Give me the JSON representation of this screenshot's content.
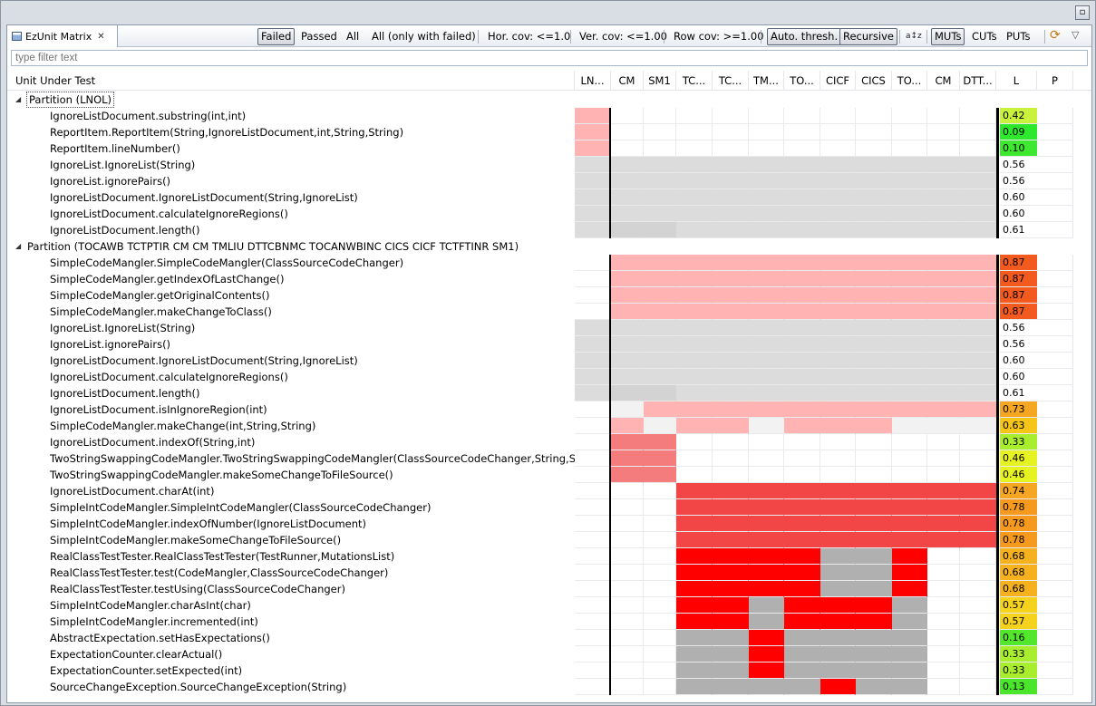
{
  "window": {
    "maximize_glyph": "▫"
  },
  "view": {
    "tab_title": "EzUnit Matrix",
    "tab_close": "✕"
  },
  "toolbar": {
    "failed": "Failed",
    "passed": "Passed",
    "all": "All",
    "all_only_failed": "All (only with failed)",
    "hor_cov": "Hor. cov: <=1.0",
    "ver_cov": "Ver. cov: <=1.00",
    "row_cov": "Row cov: >=1.00",
    "auto_thresh": "Auto. thresh.",
    "recursive": "Recursive",
    "sort_icon_glyph": "a↕z",
    "muts": "MUTs",
    "cuts": "CUTs",
    "puts": "PUTs",
    "sync_icon_glyph": "⟳",
    "menu_icon_glyph": "▽"
  },
  "filter": {
    "placeholder": "type filter text"
  },
  "columns": {
    "uut": "Unit Under Test",
    "matrix": [
      "LN...",
      "CM",
      "SM1",
      "TC...",
      "TC...",
      "TM...",
      "TO...",
      "CICF",
      "CICS",
      "TO...",
      "CM",
      "DTT..."
    ],
    "l": "L",
    "p": "P"
  },
  "colors": {
    "P": "#ffb3b3",
    "X": "#dcdcdc",
    "Y": "#d3d3d3",
    "Q": "#f2f2f2",
    "M": "#f47c7c",
    "R": "#f24545",
    "S": "#ff0000",
    "G": "#b0b0b0",
    "_": "#ffffff"
  },
  "rows": [
    {
      "type": "partition",
      "label": "Partition (LNOL)"
    },
    {
      "type": "item",
      "label": "IgnoreListDocument.substring(int,int)",
      "cells": "P___________",
      "L": "0.42",
      "Lc": "#c8f23c"
    },
    {
      "type": "item",
      "label": "ReportItem.ReportItem(String,IgnoreListDocument,int,String,String)",
      "cells": "P___________",
      "L": "0.09",
      "Lc": "#2ee82e"
    },
    {
      "type": "item",
      "label": "ReportItem.lineNumber()",
      "cells": "P___________",
      "L": "0.10",
      "Lc": "#3ee830"
    },
    {
      "type": "item",
      "label": "IgnoreList.IgnoreList(String)",
      "cells": "XXXXXXXXXXXX",
      "L": "0.56",
      "Lc": "#ffffff"
    },
    {
      "type": "item",
      "label": "IgnoreList.ignorePairs()",
      "cells": "XXXXXXXXXXXX",
      "L": "0.56",
      "Lc": "#ffffff"
    },
    {
      "type": "item",
      "label": "IgnoreListDocument.IgnoreListDocument(String,IgnoreList)",
      "cells": "XXXXXXXXXXXX",
      "L": "0.60",
      "Lc": "#ffffff"
    },
    {
      "type": "item",
      "label": "IgnoreListDocument.calculateIgnoreRegions()",
      "cells": "XXXXXXXXXXXX",
      "L": "0.60",
      "Lc": "#ffffff"
    },
    {
      "type": "item",
      "label": "IgnoreListDocument.length()",
      "cells": "XYYXXXXXXXXX",
      "L": "0.61",
      "Lc": "#ffffff"
    },
    {
      "type": "partition",
      "label": "Partition (TOCAWB TCTPTIR CM CM TMLIU DTTCBNMC TOCANWBINC CICS CICF TCTFTINR SM1)"
    },
    {
      "type": "item",
      "label": "SimpleCodeMangler.SimpleCodeMangler(ClassSourceCodeChanger)",
      "cells": "_PPPPPPPPPPP",
      "L": "0.87",
      "Lc": "#f25a1e"
    },
    {
      "type": "item",
      "label": "SimpleCodeMangler.getIndexOfLastChange()",
      "cells": "_PPPPPPPPPPP",
      "L": "0.87",
      "Lc": "#f25a1e"
    },
    {
      "type": "item",
      "label": "SimpleCodeMangler.getOriginalContents()",
      "cells": "_PPPPPPPPPPP",
      "L": "0.87",
      "Lc": "#f25a1e"
    },
    {
      "type": "item",
      "label": "SimpleCodeMangler.makeChangeToClass()",
      "cells": "_PPPPPPPPPPP",
      "L": "0.87",
      "Lc": "#f25a1e"
    },
    {
      "type": "item",
      "label": "IgnoreList.IgnoreList(String)",
      "cells": "XXXXXXXXXXXX",
      "L": "0.56",
      "Lc": "#ffffff"
    },
    {
      "type": "item",
      "label": "IgnoreList.ignorePairs()",
      "cells": "XXXXXXXXXXXX",
      "L": "0.56",
      "Lc": "#ffffff"
    },
    {
      "type": "item",
      "label": "IgnoreListDocument.IgnoreListDocument(String,IgnoreList)",
      "cells": "XXXXXXXXXXXX",
      "L": "0.60",
      "Lc": "#ffffff"
    },
    {
      "type": "item",
      "label": "IgnoreListDocument.calculateIgnoreRegions()",
      "cells": "XXXXXXXXXXXX",
      "L": "0.60",
      "Lc": "#ffffff"
    },
    {
      "type": "item",
      "label": "IgnoreListDocument.length()",
      "cells": "XYYXXXXXXXXX",
      "L": "0.61",
      "Lc": "#ffffff"
    },
    {
      "type": "item",
      "label": "IgnoreListDocument.isInIgnoreRegion(int)",
      "cells": "_QPPPPPPPPPP",
      "L": "0.73",
      "Lc": "#f5a623"
    },
    {
      "type": "item",
      "label": "SimpleCodeMangler.makeChange(int,String,String)",
      "cells": "_PQPPQPPPQQQ",
      "L": "0.63",
      "Lc": "#f5c518"
    },
    {
      "type": "item",
      "label": "IgnoreListDocument.indexOf(String,int)",
      "cells": "_MM_________",
      "L": "0.33",
      "Lc": "#a8ee2e"
    },
    {
      "type": "item",
      "label": "TwoStringSwappingCodeMangler.TwoStringSwappingCodeMangler(ClassSourceCodeChanger,String,String)",
      "cells": "_MM_________",
      "L": "0.46",
      "Lc": "#e6f221"
    },
    {
      "type": "item",
      "label": "TwoStringSwappingCodeMangler.makeSomeChangeToFileSource()",
      "cells": "_MM_________",
      "L": "0.46",
      "Lc": "#e6f221"
    },
    {
      "type": "item",
      "label": "IgnoreListDocument.charAt(int)",
      "cells": "___RRRRRRRRR",
      "L": "0.74",
      "Lc": "#f5a623"
    },
    {
      "type": "item",
      "label": "SimpleIntCodeMangler.SimpleIntCodeMangler(ClassSourceCodeChanger)",
      "cells": "___RRRRRRRRR",
      "L": "0.78",
      "Lc": "#f59a1e"
    },
    {
      "type": "item",
      "label": "SimpleIntCodeMangler.indexOfNumber(IgnoreListDocument)",
      "cells": "___RRRRRRRRR",
      "L": "0.78",
      "Lc": "#f59a1e"
    },
    {
      "type": "item",
      "label": "SimpleIntCodeMangler.makeSomeChangeToFileSource()",
      "cells": "___RRRRRRRRR",
      "L": "0.78",
      "Lc": "#f59a1e"
    },
    {
      "type": "item",
      "label": "RealClassTestTester.RealClassTestTester(TestRunner,MutationsList)",
      "cells": "___SSSSGGS__",
      "L": "0.68",
      "Lc": "#f5b21e"
    },
    {
      "type": "item",
      "label": "RealClassTestTester.test(CodeMangler,ClassSourceCodeChanger)",
      "cells": "___SSSSGGS__",
      "L": "0.68",
      "Lc": "#f5b21e"
    },
    {
      "type": "item",
      "label": "RealClassTestTester.testUsing(ClassSourceCodeChanger)",
      "cells": "___SSSSGGS__",
      "L": "0.68",
      "Lc": "#f5b21e"
    },
    {
      "type": "item",
      "label": "SimpleIntCodeMangler.charAsInt(char)",
      "cells": "___SSGSSSG__",
      "L": "0.57",
      "Lc": "#f5d21e"
    },
    {
      "type": "item",
      "label": "SimpleIntCodeMangler.incremented(int)",
      "cells": "___SSGSSSG__",
      "L": "0.57",
      "Lc": "#f5d21e"
    },
    {
      "type": "item",
      "label": "AbstractExpectation.setHasExpectations()",
      "cells": "___GGSGGGG__",
      "L": "0.16",
      "Lc": "#52e62c"
    },
    {
      "type": "item",
      "label": "ExpectationCounter.clearActual()",
      "cells": "___GGSGGGG__",
      "L": "0.33",
      "Lc": "#a8ee2e"
    },
    {
      "type": "item",
      "label": "ExpectationCounter.setExpected(int)",
      "cells": "___GGSGGGG__",
      "L": "0.33",
      "Lc": "#a8ee2e"
    },
    {
      "type": "item",
      "label": "SourceChangeException.SourceChangeException(String)",
      "cells": "___GGGGSGG__",
      "L": "0.13",
      "Lc": "#4ae62c"
    }
  ]
}
